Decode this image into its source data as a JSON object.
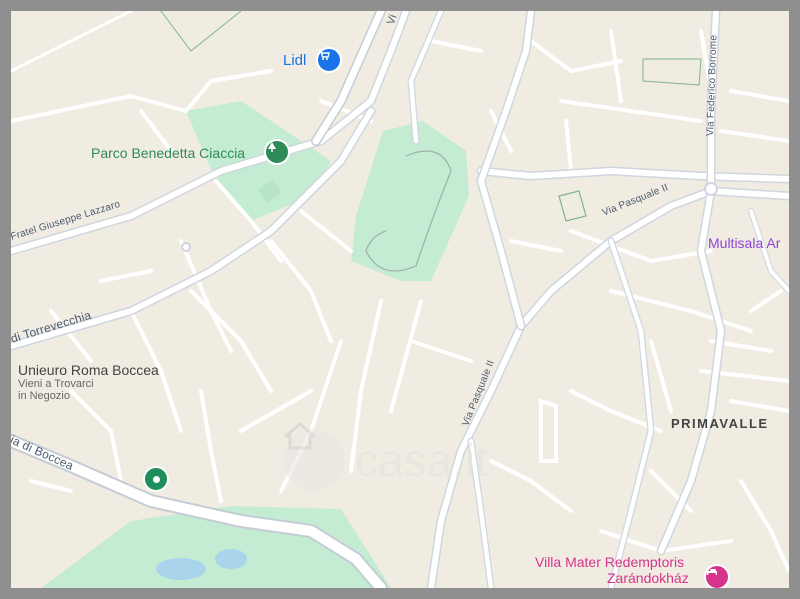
{
  "map": {
    "poi": {
      "lidl": {
        "label": "Lidl",
        "icon": "shopping-cart-icon",
        "color": "#1a73e8"
      },
      "parco": {
        "label": "Parco Benedetta Ciaccia",
        "icon": "tree-icon",
        "color": "#2e8b57"
      },
      "multisala": {
        "label": "Multisala Ar",
        "color": "#8e44d6"
      },
      "unieuro": {
        "label": "Unieuro Roma Boccea",
        "subtitle_line1": "Vieni a Trovarci",
        "subtitle_line2": "in Negozio"
      },
      "villa": {
        "label_line1": "Villa Mater Redemptoris",
        "label_line2": "Zarándokház",
        "icon": "hotel-bed-icon",
        "color": "#d6338c"
      },
      "boccea_pin": {
        "icon": "place-pin-icon",
        "color": "#1e8e5a"
      }
    },
    "roads": {
      "federico": "Via Federico Borrome",
      "pasquale_east": "Via Pasquale II",
      "pasquale_south": "Via Pasquale II",
      "fratel": "Fratel Giuseppe Lazzaro",
      "torrevecchia": "di Torrevecchia",
      "boccea": "ia di Boccea",
      "top_via": "Vi"
    },
    "district": "PRIMAVALLE",
    "watermark": "casa.it"
  }
}
